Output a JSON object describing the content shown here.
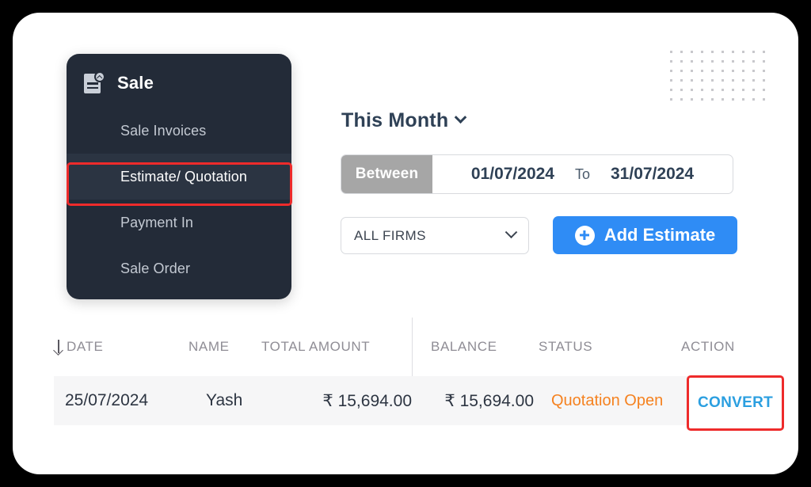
{
  "sidebar": {
    "icon": "sale-document-icon",
    "title": "Sale",
    "items": [
      {
        "label": "Sale Invoices",
        "active": false
      },
      {
        "label": "Estimate/ Quotation",
        "active": true
      },
      {
        "label": "Payment In",
        "active": false
      },
      {
        "label": "Sale Order",
        "active": false
      }
    ]
  },
  "filters": {
    "period_label": "This Month",
    "period_chevron_icon": "chevron-down-icon",
    "range_mode": "Between",
    "date_from": "01/07/2024",
    "date_to_separator": "To",
    "date_to": "31/07/2024",
    "firm_selected": "ALL FIRMS",
    "firm_chevron_icon": "chevron-down-icon",
    "add_button_label": "Add Estimate",
    "add_button_icon": "plus-circle-icon",
    "add_button_color": "#2f8cf5",
    "between_bg_color": "#a6a6a6"
  },
  "table": {
    "sort_icon": "sort-descending-arrow-icon",
    "columns": [
      "DATE",
      "NAME",
      "TOTAL AMOUNT",
      "BALANCE",
      "STATUS",
      "ACTION"
    ],
    "rows": [
      {
        "date": "25/07/2024",
        "name": "Yash",
        "total_amount": "₹ 15,694.00",
        "balance": "₹ 15,694.00",
        "status": "Quotation Open",
        "status_color": "#f58220",
        "action": "CONVERT",
        "action_color": "#2b9fe0"
      }
    ]
  },
  "annotations": {
    "highlight_color": "#ee2b2b",
    "highlighted_sidebar_item": "Estimate/ Quotation",
    "highlighted_action": "CONVERT"
  },
  "decor": {
    "dot_grid_name": "dot-grid-decoration",
    "dot_columns": 10,
    "dot_rows": 6,
    "dot_color": "#c8c8cc"
  }
}
